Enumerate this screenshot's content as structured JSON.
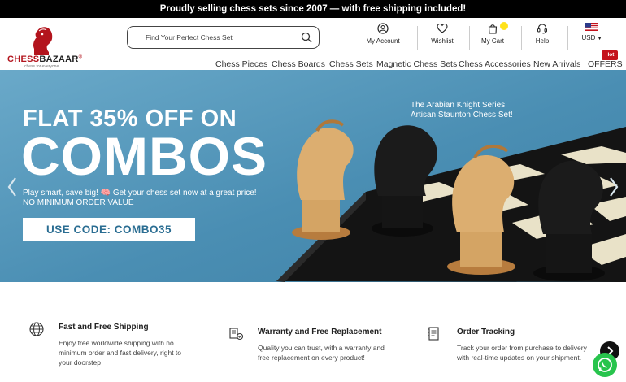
{
  "announcement": "Proudly selling chess sets since 2007 — with free shipping included!",
  "brand": {
    "name_part1": "CHESS",
    "name_part2": "BAZAAR",
    "registered": "®",
    "tagline": "chess for everyone",
    "color": "#b3141d"
  },
  "search": {
    "placeholder": "Find Your Perfect Chess Set"
  },
  "header_actions": [
    {
      "label": "My Account",
      "icon": "user-icon"
    },
    {
      "label": "Wishlist",
      "icon": "heart-icon"
    },
    {
      "label": "My Cart",
      "icon": "bag-icon"
    },
    {
      "label": "Help",
      "icon": "headset-icon"
    }
  ],
  "currency": {
    "label": "USD",
    "icon": "us-flag-icon"
  },
  "nav": [
    {
      "label": "Chess Pieces"
    },
    {
      "label": "Chess Boards"
    },
    {
      "label": "Chess Sets"
    },
    {
      "label": "Magnetic Chess Sets"
    },
    {
      "label": "Chess Accessories"
    },
    {
      "label": "New Arrivals"
    },
    {
      "label": "OFFERS",
      "badge": "Hot"
    }
  ],
  "hero": {
    "headline_small": "FLAT 35% OFF ON",
    "headline_big": "COMBOS",
    "subline": "Play smart, save big! 🧠 Get your chess set now at a great price!",
    "subline2": "NO MINIMUM ORDER VALUE",
    "code_button": "USE CODE: COMBO35",
    "series_line1": "The Arabian Knight Series",
    "series_line2": "Artisan Staunton Chess Set!",
    "bg_color": "#4a8eb3"
  },
  "features": [
    {
      "title": "Fast and Free Shipping",
      "desc": "Enjoy free worldwide shipping with no minimum order and fast delivery, right to your doorstep",
      "icon": "globe-icon"
    },
    {
      "title": "Warranty and Free Replacement",
      "desc": "Quality you can trust, with a warranty and free replacement on every product!",
      "icon": "warranty-icon"
    },
    {
      "title": "Order Tracking",
      "desc": "Track your order from purchase to delivery with real-time updates on your shipment.",
      "icon": "tracking-icon"
    }
  ]
}
